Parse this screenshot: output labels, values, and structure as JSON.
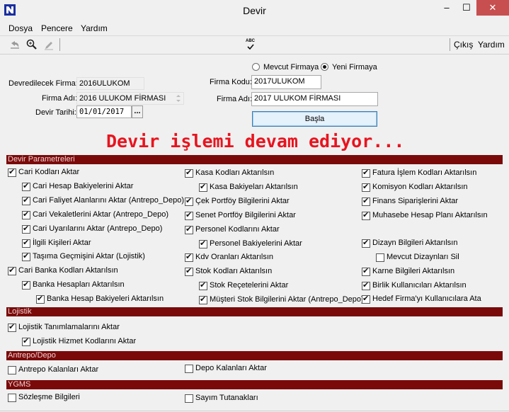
{
  "window": {
    "title": "Devir",
    "min": "–",
    "max": "☐",
    "close": "✕"
  },
  "menu": [
    "Dosya",
    "Pencere",
    "Yardım"
  ],
  "toolbar": {
    "right_labels": [
      "Çıkış",
      "Yardım"
    ],
    "abc_label": "ABC"
  },
  "left": {
    "devredilecek_label": "Devredilecek Firma:",
    "devredilecek_value": "2016ULUKOM",
    "firma_adi_label": "Firma Adı:",
    "firma_adi_value": "2016 ULUKOM FİRMASI",
    "devir_tarihi_label": "Devir Tarihi:",
    "devir_tarihi_value": "01/01/2017",
    "date_btn": "..."
  },
  "right": {
    "radio_mevcut": "Mevcut Firmaya",
    "radio_yeni": "Yeni Firmaya",
    "firma_kodu_label": "Firma Kodu:",
    "firma_kodu_value": "2017ULUKOM",
    "firma_adi_label": "Firma Adı:",
    "firma_adi_value": "2017 ULUKOM FİRMASI",
    "basla": "Başla"
  },
  "progress_message": "Devir işlemi devam ediyor...",
  "sections": [
    "Devir Parametreleri",
    "Lojistik",
    "Antrepo/Depo",
    "YGMS"
  ],
  "checkboxes": [
    {
      "label": "Cari Kodları Aktar",
      "checked": true
    },
    {
      "label": "Cari Hesap Bakiyelerini Aktar",
      "checked": true
    },
    {
      "label": "Cari Faliyet Alanlarını Aktar (Antrepo_Depo)",
      "checked": true
    },
    {
      "label": "Cari Vekaletlerini Aktar (Antrepo_Depo)",
      "checked": true
    },
    {
      "label": "Cari Uyarılarını Aktar (Antrepo_Depo)",
      "checked": true
    },
    {
      "label": "İlgili Kişileri Aktar",
      "checked": true
    },
    {
      "label": "Taşıma Geçmişini Aktar (Lojistik)",
      "checked": true
    },
    {
      "label": "Cari Banka Kodları Aktarılsın",
      "checked": true
    },
    {
      "label": "Banka Hesapları Aktarılsın",
      "checked": true
    },
    {
      "label": "Banka Hesap Bakiyeleri Aktarılsın",
      "checked": true
    },
    {
      "label": "Kasa Kodları Aktarılsın",
      "checked": true
    },
    {
      "label": "Kasa Bakiyeları Aktarılsın",
      "checked": true
    },
    {
      "label": "Çek Portföy Bilgilerini Aktar",
      "checked": true
    },
    {
      "label": "Senet Portföy Bilgilerini Aktar",
      "checked": true
    },
    {
      "label": "Personel Kodlarını Aktar",
      "checked": true
    },
    {
      "label": "Personel Bakiyelerini Aktar",
      "checked": true
    },
    {
      "label": "Kdv Oranları Aktarılsın",
      "checked": true
    },
    {
      "label": "Stok Kodları Aktarılsın",
      "checked": true
    },
    {
      "label": "Stok Reçetelerini Aktar",
      "checked": true
    },
    {
      "label": "Müşteri Stok Bilgilerini Aktar (Antrepo_Depo)",
      "checked": true
    },
    {
      "label": "Fatura İşlem Kodları Aktarılsın",
      "checked": true
    },
    {
      "label": "Komisyon Kodları Aktarılsın",
      "checked": true
    },
    {
      "label": "Finans Siparişlerini Aktar",
      "checked": true
    },
    {
      "label": "Muhasebe Hesap Planı Aktarılsın",
      "checked": true
    },
    {
      "label": "Dizayn Bilgileri Aktarılsın",
      "checked": true
    },
    {
      "label": "Mevcut Dizaynları Sil",
      "checked": false
    },
    {
      "label": "Karne Bilgileri Aktarılsın",
      "checked": true
    },
    {
      "label": "Birlik Kullanıcıları Aktarılsın",
      "checked": true
    },
    {
      "label": "Hedef Firma'yı Kullanıcılara Ata",
      "checked": true
    },
    {
      "label": "Lojistik Tanımlamalarını Aktar",
      "checked": true
    },
    {
      "label": "Lojistik Hizmet Kodlarını Aktar",
      "checked": true
    },
    {
      "label": "Antrepo Kalanları Aktar",
      "checked": false
    },
    {
      "label": "Depo Kalanları Aktar",
      "checked": false
    },
    {
      "label": "Sözleşme Bilgileri",
      "checked": false
    },
    {
      "label": "Sayım Tutanakları",
      "checked": false
    }
  ]
}
